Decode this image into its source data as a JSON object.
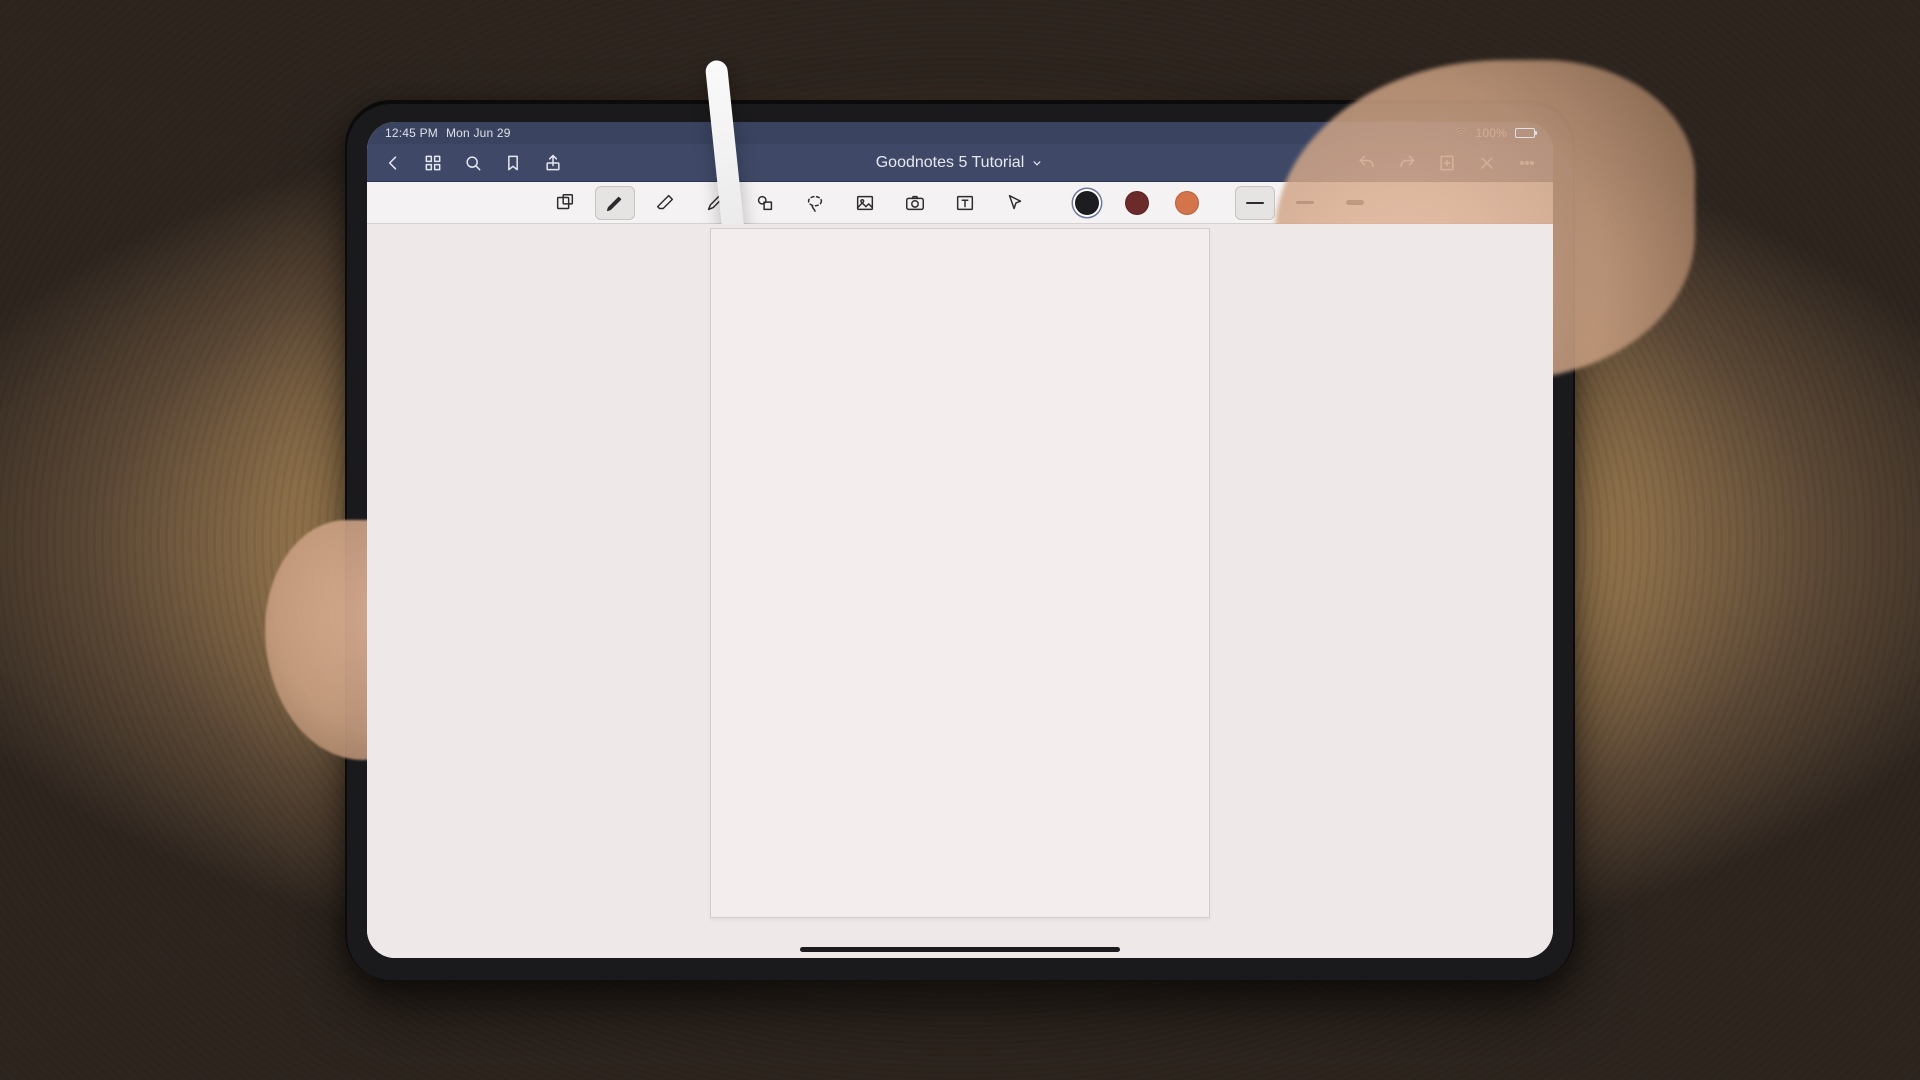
{
  "statusbar": {
    "time": "12:45 PM",
    "date": "Mon Jun 29",
    "battery_percent": "100%"
  },
  "titlebar": {
    "doc_title": "Goodnotes 5 Tutorial"
  },
  "toolbar": {
    "colors": [
      {
        "name": "black",
        "hex": "#1d1d1f",
        "selected": true
      },
      {
        "name": "dark-red",
        "hex": "#6b2b2b",
        "selected": false
      },
      {
        "name": "orange",
        "hex": "#d3744a",
        "selected": false
      }
    ],
    "strokes": [
      {
        "thickness_px": 2,
        "selected": true
      },
      {
        "thickness_px": 3,
        "selected": false
      },
      {
        "thickness_px": 5,
        "selected": false
      }
    ],
    "selected_tool": "pen"
  }
}
